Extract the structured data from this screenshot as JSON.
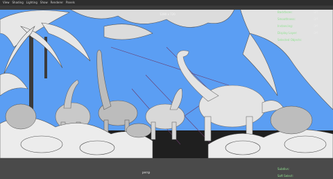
{
  "menubar": {
    "items": [
      "View",
      "Shading",
      "Lighting",
      "Show",
      "Renderer",
      "Panels"
    ]
  },
  "hud": {
    "resolution": "1280 x 720",
    "stats": [
      {
        "label": "Backfaces:",
        "value": "Off"
      },
      {
        "label": "Smoothness:",
        "value": "Off"
      },
      {
        "label": "Instancing:",
        "value": "Off"
      },
      {
        "label": "Display Layer:",
        "value": "Off"
      },
      {
        "label": "Selected Objects:",
        "value": ""
      }
    ],
    "camera_label": "persp",
    "bottom_stats": [
      {
        "label": "Subdivs:",
        "value": ""
      },
      {
        "label": "Soft Select:",
        "value": ""
      }
    ]
  },
  "colors": {
    "sky": "#5b9ef3",
    "label": "#8fe38f"
  }
}
